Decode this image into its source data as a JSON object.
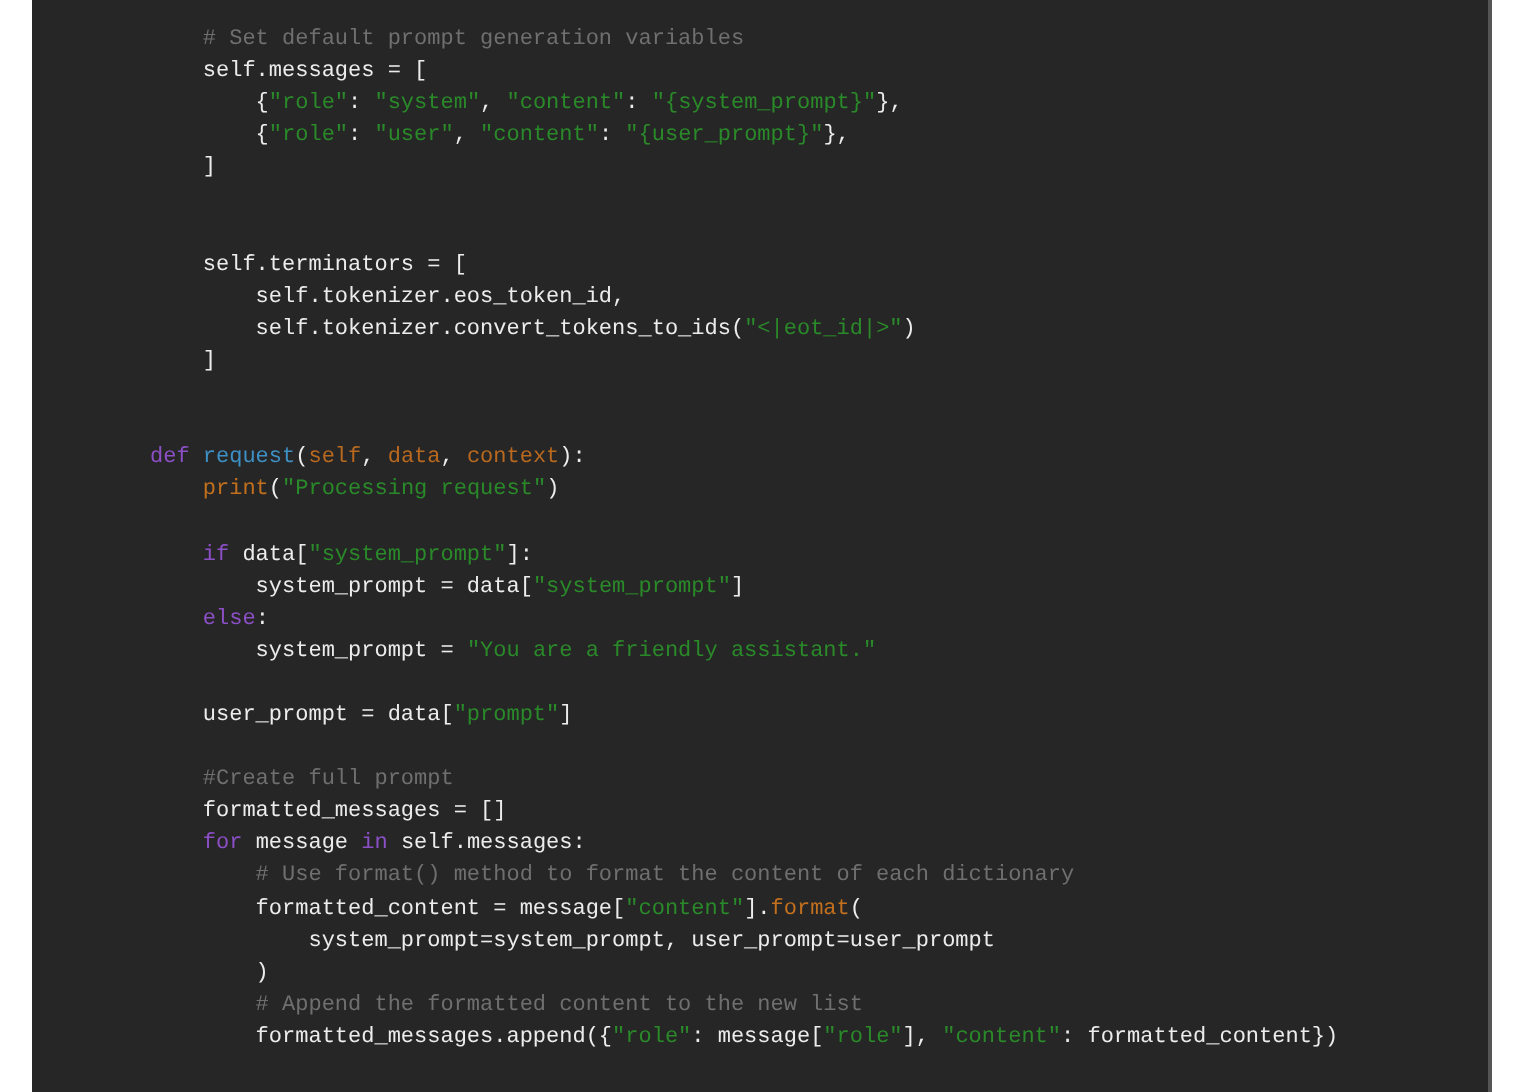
{
  "code_lines": [
    {
      "kind": "code",
      "tokens": [
        {
          "kind": "comment",
          "text": "    # Set default prompt generation variables"
        }
      ]
    },
    {
      "kind": "code",
      "tokens": [
        {
          "kind": "plain",
          "text": "    self.messages = ["
        }
      ]
    },
    {
      "kind": "code",
      "tokens": [
        {
          "kind": "plain",
          "text": "        {"
        },
        {
          "kind": "string",
          "text": "\"role\""
        },
        {
          "kind": "plain",
          "text": ": "
        },
        {
          "kind": "string",
          "text": "\"system\""
        },
        {
          "kind": "plain",
          "text": ", "
        },
        {
          "kind": "string",
          "text": "\"content\""
        },
        {
          "kind": "plain",
          "text": ": "
        },
        {
          "kind": "string",
          "text": "\"{system_prompt}\""
        },
        {
          "kind": "plain",
          "text": "},"
        }
      ]
    },
    {
      "kind": "code",
      "tokens": [
        {
          "kind": "plain",
          "text": "        {"
        },
        {
          "kind": "string",
          "text": "\"role\""
        },
        {
          "kind": "plain",
          "text": ": "
        },
        {
          "kind": "string",
          "text": "\"user\""
        },
        {
          "kind": "plain",
          "text": ", "
        },
        {
          "kind": "string",
          "text": "\"content\""
        },
        {
          "kind": "plain",
          "text": ": "
        },
        {
          "kind": "string",
          "text": "\"{user_prompt}\""
        },
        {
          "kind": "plain",
          "text": "},"
        }
      ]
    },
    {
      "kind": "code",
      "tokens": [
        {
          "kind": "plain",
          "text": "    ]"
        }
      ]
    },
    {
      "kind": "blank"
    },
    {
      "kind": "blank"
    },
    {
      "kind": "code",
      "tokens": [
        {
          "kind": "plain",
          "text": "    self.terminators = ["
        }
      ]
    },
    {
      "kind": "code",
      "tokens": [
        {
          "kind": "plain",
          "text": "        self.tokenizer.eos_token_id,"
        }
      ]
    },
    {
      "kind": "code",
      "tokens": [
        {
          "kind": "plain",
          "text": "        self.tokenizer.convert_tokens_to_ids("
        },
        {
          "kind": "string",
          "text": "\"<|eot_id|>\""
        },
        {
          "kind": "plain",
          "text": ")"
        }
      ]
    },
    {
      "kind": "code",
      "tokens": [
        {
          "kind": "plain",
          "text": "    ]"
        }
      ]
    },
    {
      "kind": "blank"
    },
    {
      "kind": "blank"
    },
    {
      "kind": "code",
      "tokens": [
        {
          "kind": "keyword",
          "text": "def "
        },
        {
          "kind": "function",
          "text": "request"
        },
        {
          "kind": "plain",
          "text": "("
        },
        {
          "kind": "param",
          "text": "self"
        },
        {
          "kind": "plain",
          "text": ", "
        },
        {
          "kind": "param",
          "text": "data"
        },
        {
          "kind": "plain",
          "text": ", "
        },
        {
          "kind": "param",
          "text": "context"
        },
        {
          "kind": "plain",
          "text": "):"
        }
      ]
    },
    {
      "kind": "code",
      "tokens": [
        {
          "kind": "builtin",
          "text": "    print"
        },
        {
          "kind": "plain",
          "text": "("
        },
        {
          "kind": "string",
          "text": "\"Processing request\""
        },
        {
          "kind": "plain",
          "text": ")"
        }
      ]
    },
    {
      "kind": "blank"
    },
    {
      "kind": "code",
      "tokens": [
        {
          "kind": "keyword",
          "text": "    if"
        },
        {
          "kind": "plain",
          "text": " data["
        },
        {
          "kind": "string",
          "text": "\"system_prompt\""
        },
        {
          "kind": "plain",
          "text": "]:"
        }
      ]
    },
    {
      "kind": "code",
      "tokens": [
        {
          "kind": "plain",
          "text": "        system_prompt = data["
        },
        {
          "kind": "string",
          "text": "\"system_prompt\""
        },
        {
          "kind": "plain",
          "text": "]"
        }
      ]
    },
    {
      "kind": "code",
      "tokens": [
        {
          "kind": "keyword",
          "text": "    else"
        },
        {
          "kind": "plain",
          "text": ":"
        }
      ]
    },
    {
      "kind": "code",
      "tokens": [
        {
          "kind": "plain",
          "text": "        system_prompt = "
        },
        {
          "kind": "string",
          "text": "\"You are a friendly assistant.\""
        }
      ]
    },
    {
      "kind": "blank"
    },
    {
      "kind": "code",
      "tokens": [
        {
          "kind": "plain",
          "text": "    user_prompt = data["
        },
        {
          "kind": "string",
          "text": "\"prompt\""
        },
        {
          "kind": "plain",
          "text": "]"
        }
      ]
    },
    {
      "kind": "blank"
    },
    {
      "kind": "code",
      "tokens": [
        {
          "kind": "comment",
          "text": "    #Create full prompt"
        }
      ]
    },
    {
      "kind": "code",
      "tokens": [
        {
          "kind": "plain",
          "text": "    formatted_messages = []"
        }
      ]
    },
    {
      "kind": "code",
      "tokens": [
        {
          "kind": "keyword",
          "text": "    for"
        },
        {
          "kind": "plain",
          "text": " message "
        },
        {
          "kind": "keyword",
          "text": "in"
        },
        {
          "kind": "plain",
          "text": " self.messages:"
        }
      ]
    },
    {
      "kind": "code",
      "tokens": [
        {
          "kind": "comment",
          "text": "        # Use format() method to format the content of each dictionary"
        }
      ]
    },
    {
      "kind": "code",
      "tokens": [
        {
          "kind": "plain",
          "text": "        formatted_content = message["
        },
        {
          "kind": "string",
          "text": "\"content\""
        },
        {
          "kind": "plain",
          "text": "]."
        },
        {
          "kind": "builtin",
          "text": "format"
        },
        {
          "kind": "plain",
          "text": "("
        }
      ]
    },
    {
      "kind": "code",
      "tokens": [
        {
          "kind": "plain",
          "text": "            system_prompt=system_prompt, user_prompt=user_prompt"
        }
      ]
    },
    {
      "kind": "code",
      "tokens": [
        {
          "kind": "plain",
          "text": "        )"
        }
      ]
    },
    {
      "kind": "code",
      "tokens": [
        {
          "kind": "comment",
          "text": "        # Append the formatted content to the new list"
        }
      ]
    },
    {
      "kind": "code",
      "tokens": [
        {
          "kind": "plain",
          "text": "        formatted_messages.append({"
        },
        {
          "kind": "string",
          "text": "\"role\""
        },
        {
          "kind": "plain",
          "text": ": message["
        },
        {
          "kind": "string",
          "text": "\"role\""
        },
        {
          "kind": "plain",
          "text": "], "
        },
        {
          "kind": "string",
          "text": "\"content\""
        },
        {
          "kind": "plain",
          "text": ": formatted_content})"
        }
      ]
    }
  ]
}
